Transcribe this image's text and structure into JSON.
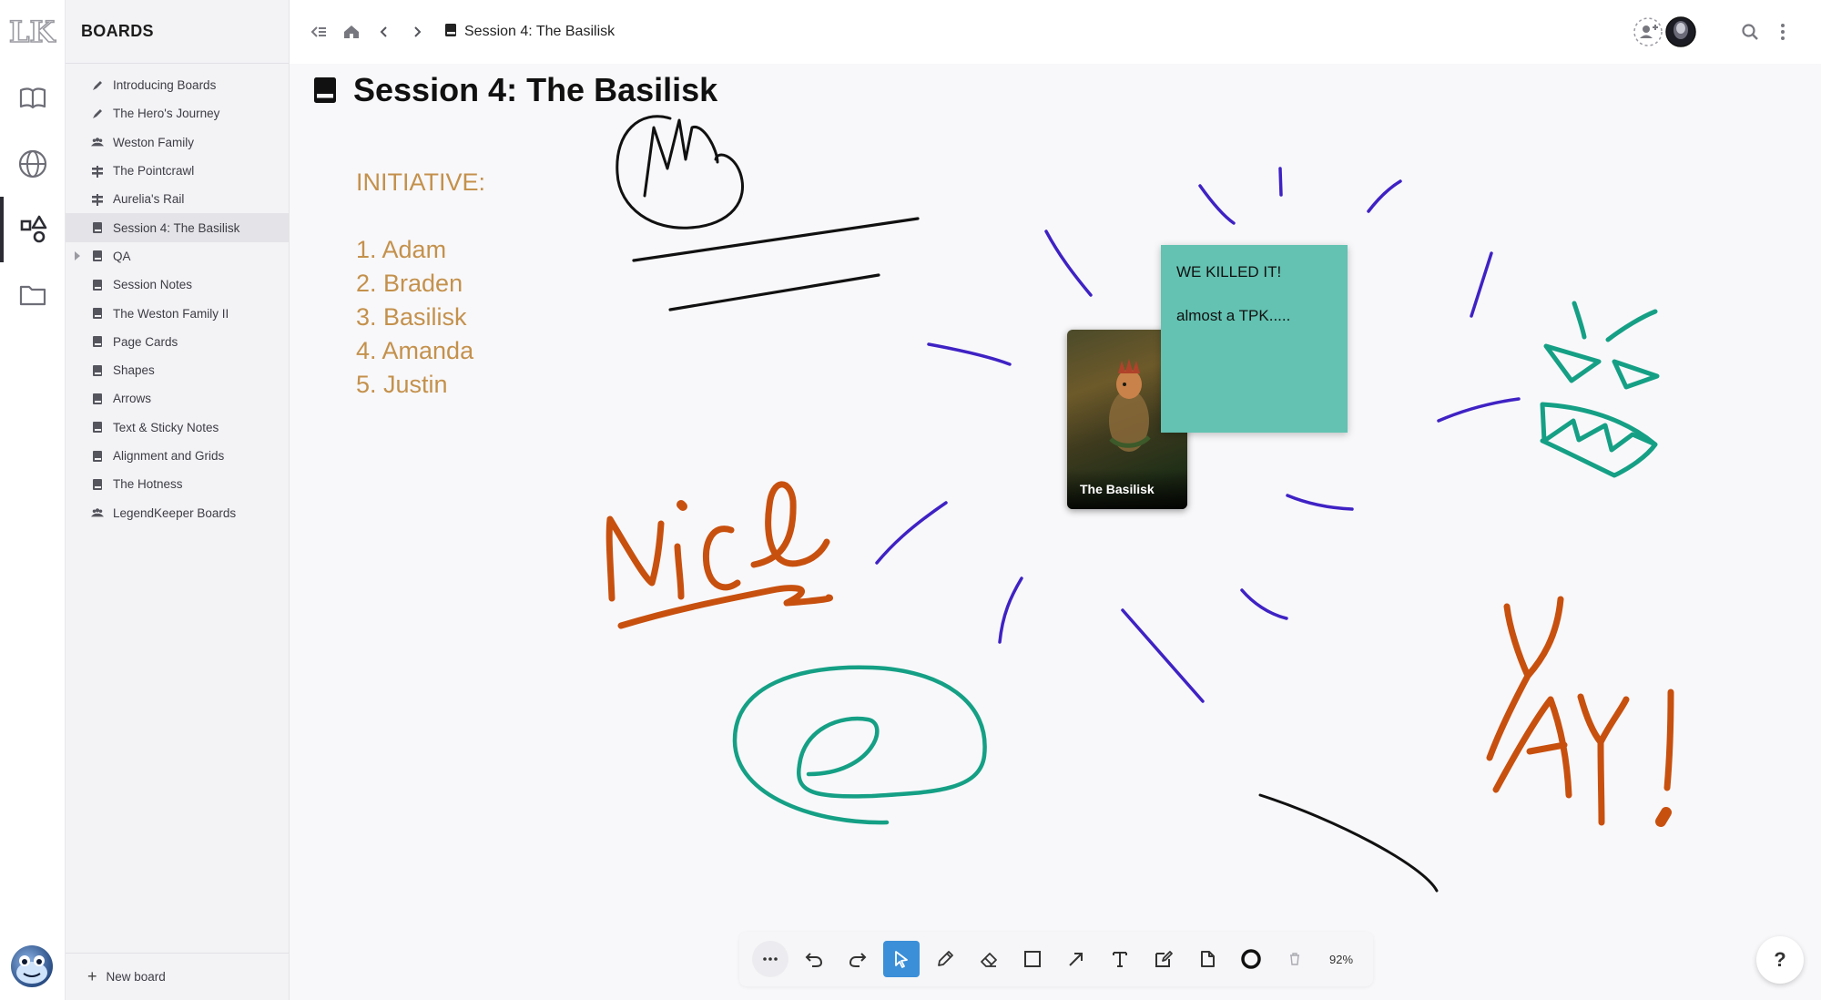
{
  "app": {
    "logo_text": "LK"
  },
  "rail": {
    "items": [
      {
        "icon": "book-icon"
      },
      {
        "icon": "globe-icon"
      },
      {
        "icon": "shapes-icon"
      },
      {
        "icon": "folder-icon"
      }
    ]
  },
  "sidebar": {
    "title": "BOARDS",
    "items": [
      {
        "label": "Introducing Boards",
        "icon": "pen-icon"
      },
      {
        "label": "The Hero's Journey",
        "icon": "pen-icon"
      },
      {
        "label": "Weston Family",
        "icon": "people-icon"
      },
      {
        "label": "The Pointcrawl",
        "icon": "signpost-icon"
      },
      {
        "label": "Aurelia's Rail",
        "icon": "signpost-icon"
      },
      {
        "label": "Session 4: The Basilisk",
        "icon": "book-icon"
      },
      {
        "label": "QA",
        "icon": "book-icon"
      },
      {
        "label": "Session Notes",
        "icon": "book-icon"
      },
      {
        "label": "The Weston Family II",
        "icon": "book-icon"
      },
      {
        "label": "Page Cards",
        "icon": "book-icon"
      },
      {
        "label": "Shapes",
        "icon": "book-icon"
      },
      {
        "label": "Arrows",
        "icon": "book-icon"
      },
      {
        "label": "Text & Sticky Notes",
        "icon": "book-icon"
      },
      {
        "label": "Alignment and Grids",
        "icon": "book-icon"
      },
      {
        "label": "The Hotness",
        "icon": "book-icon"
      },
      {
        "label": "LegendKeeper Boards",
        "icon": "people-icon"
      }
    ],
    "new_board_label": "New board"
  },
  "topbar": {
    "breadcrumb": "Session 4: The Basilisk"
  },
  "board": {
    "title": "Session 4: The Basilisk",
    "initiative_heading": "INITIATIVE:",
    "initiative": [
      "1. Adam",
      "2. Braden",
      "3. Basilisk",
      "4. Amanda",
      "5. Justin"
    ],
    "sticky_lines": [
      "WE KILLED IT!",
      "almost a TPK....."
    ],
    "card_label": "The Basilisk",
    "colors": {
      "initiative_text": "#c4914c",
      "sticky": "#63c2b2",
      "ink_black": "#111111",
      "ink_purple": "#3f22c4",
      "ink_teal": "#15a085",
      "ink_orange": "#c8500e"
    }
  },
  "toolbar": {
    "zoom": "92%",
    "active_tool": "select"
  },
  "help": {
    "label": "?"
  }
}
